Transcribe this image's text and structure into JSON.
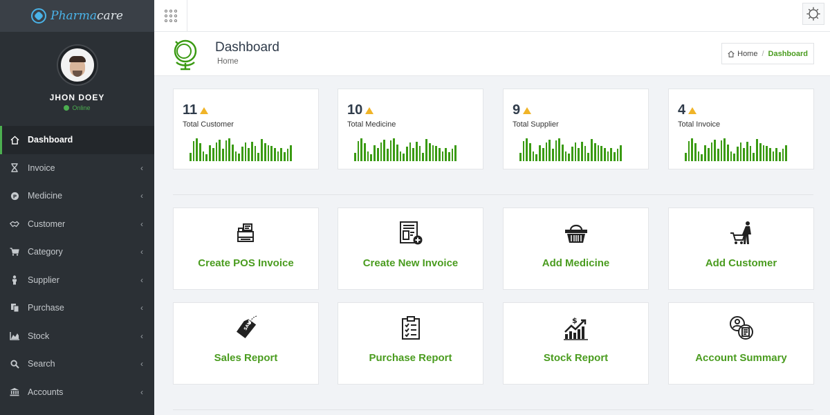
{
  "app": {
    "logo_prefix": "Pharma",
    "logo_suffix": "care"
  },
  "user": {
    "name": "JHON DOEY",
    "status": "Online"
  },
  "sidebar": {
    "items": [
      {
        "label": "Dashboard",
        "icon": "home-icon"
      },
      {
        "label": "Invoice",
        "icon": "hourglass-icon"
      },
      {
        "label": "Medicine",
        "icon": "pill-icon"
      },
      {
        "label": "Customer",
        "icon": "handshake-icon"
      },
      {
        "label": "Category",
        "icon": "cart-icon"
      },
      {
        "label": "Supplier",
        "icon": "person-icon"
      },
      {
        "label": "Purchase",
        "icon": "copy-icon"
      },
      {
        "label": "Stock",
        "icon": "area-chart-icon"
      },
      {
        "label": "Search",
        "icon": "search-icon"
      },
      {
        "label": "Accounts",
        "icon": "bank-icon"
      }
    ]
  },
  "header": {
    "title": "Dashboard",
    "subtitle": "Home",
    "breadcrumb_home": "Home",
    "breadcrumb_sep": "/",
    "breadcrumb_active": "Dashboard"
  },
  "stats": [
    {
      "value": "11",
      "label": "Total Customer"
    },
    {
      "value": "10",
      "label": "Total Medicine"
    },
    {
      "value": "9",
      "label": "Total Supplier"
    },
    {
      "value": "4",
      "label": "Total Invoice"
    }
  ],
  "sparkline": [
    12,
    28,
    32,
    25,
    14,
    10,
    22,
    18,
    26,
    30,
    17,
    29,
    32,
    23,
    14,
    11,
    20,
    26,
    18,
    27,
    21,
    12,
    31,
    25,
    22,
    21,
    18,
    14,
    18,
    13,
    17,
    22
  ],
  "actions": [
    {
      "label": "Create POS Invoice",
      "icon": "pos-register-icon"
    },
    {
      "label": "Create New Invoice",
      "icon": "new-invoice-icon"
    },
    {
      "label": "Add Medicine",
      "icon": "basket-icon"
    },
    {
      "label": "Add Customer",
      "icon": "shopper-cart-icon"
    },
    {
      "label": "Sales Report",
      "icon": "sale-tag-icon"
    },
    {
      "label": "Purchase Report",
      "icon": "clipboard-checklist-icon"
    },
    {
      "label": "Stock Report",
      "icon": "growth-chart-icon"
    },
    {
      "label": "Account Summary",
      "icon": "user-document-icon"
    }
  ],
  "colors": {
    "accent": "#4a9c1f",
    "sidebar": "#2b3035",
    "trend": "#f0b428"
  }
}
